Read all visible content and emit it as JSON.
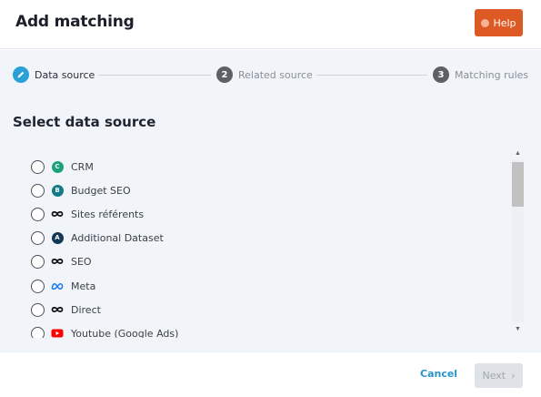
{
  "header": {
    "title": "Add matching",
    "help_label": "Help"
  },
  "stepper": {
    "steps": [
      {
        "number": "1",
        "label": "Data source",
        "state": "active"
      },
      {
        "number": "2",
        "label": "Related source",
        "state": "inactive"
      },
      {
        "number": "3",
        "label": "Matching rules",
        "state": "inactive"
      }
    ]
  },
  "main": {
    "section_title": "Select data source",
    "sources": [
      {
        "label": "CRM",
        "icon": "crm-badge-icon",
        "badge": "C",
        "color": "#1aa37a"
      },
      {
        "label": "Budget SEO",
        "icon": "budget-seo-badge-icon",
        "badge": "B",
        "color": "#137a8a"
      },
      {
        "label": "Sites référents",
        "icon": "infinity-icon"
      },
      {
        "label": "Additional Dataset",
        "icon": "additional-dataset-badge-icon",
        "badge": "A",
        "color": "#123a56"
      },
      {
        "label": "SEO",
        "icon": "infinity-icon"
      },
      {
        "label": "Meta",
        "icon": "meta-icon",
        "color": "#1877f2"
      },
      {
        "label": "Direct",
        "icon": "infinity-icon"
      },
      {
        "label": "Youtube (Google Ads)",
        "icon": "youtube-icon",
        "color": "#ff0000"
      }
    ]
  },
  "footer": {
    "cancel_label": "Cancel",
    "next_label": "Next"
  }
}
